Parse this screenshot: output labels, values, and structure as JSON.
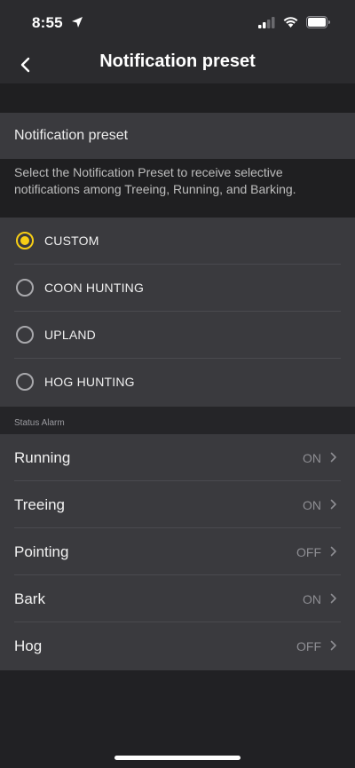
{
  "status_bar": {
    "time": "8:55"
  },
  "nav": {
    "title": "Notification preset"
  },
  "section": {
    "title": "Notification preset",
    "description": "Select the Notification Preset to receive selective notifications among Treeing, Running, and Barking."
  },
  "presets": [
    {
      "label": "CUSTOM",
      "selected": true
    },
    {
      "label": "COON HUNTING",
      "selected": false
    },
    {
      "label": "UPLAND",
      "selected": false
    },
    {
      "label": "HOG HUNTING",
      "selected": false
    }
  ],
  "status_alarm": {
    "header": "Status Alarm",
    "items": [
      {
        "label": "Running",
        "value": "ON"
      },
      {
        "label": "Treeing",
        "value": "ON"
      },
      {
        "label": "Pointing",
        "value": "OFF"
      },
      {
        "label": "Bark",
        "value": "ON"
      },
      {
        "label": "Hog",
        "value": "OFF"
      }
    ]
  },
  "colors": {
    "accent": "#f7ce15",
    "background": "#212124",
    "cell": "#3a3a3e"
  }
}
